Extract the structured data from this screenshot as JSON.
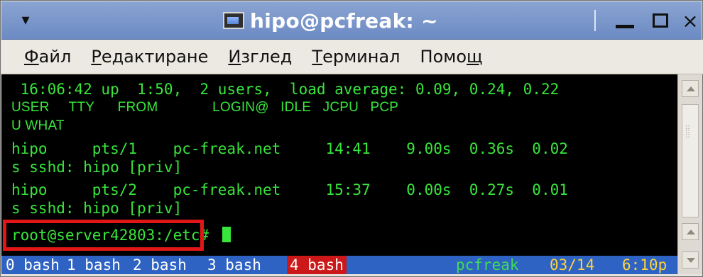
{
  "window": {
    "title": "hipo@pcfreak: ~",
    "menu_arrow": "▾",
    "controls": {
      "minimize": "minimize",
      "maximize": "maximize",
      "close": "×"
    }
  },
  "menubar": {
    "items": [
      {
        "label": "Файл",
        "prefix": "",
        "underline": "Ф",
        "rest": "айл"
      },
      {
        "label": "Редактиране",
        "prefix": "",
        "underline": "Р",
        "rest": "едактиране"
      },
      {
        "label": "Изглед",
        "prefix": "",
        "underline": "И",
        "rest": "зглед"
      },
      {
        "label": "Терминал",
        "prefix": "",
        "underline": "Т",
        "rest": "ерминал"
      },
      {
        "label": "Помощ",
        "prefix": "Помо",
        "underline": "щ",
        "rest": ""
      }
    ]
  },
  "terminal": {
    "lines": [
      " 16:06:42 up  1:50,  2 users,  load average: 0.09, 0.24, 0.22",
      "USER     TTY      FROM              LOGIN@   IDLE   JCPU   PCP",
      "U WHAT",
      "hipo     pts/1    pc-freak.net     14:41    9.00s  0.36s  0.02",
      "s sshd: hipo [priv]",
      "hipo     pts/2    pc-freak.net     15:37    0.00s  0.27s  0.01",
      "s sshd: hipo [priv]",
      "root@server42803:/etc# "
    ],
    "statusbar": {
      "tabs": [
        "0 bash",
        "1 bash",
        "2 bash",
        "3 bash",
        "4 bash"
      ],
      "active_tab": "4 bash",
      "host": "pcfreak",
      "date": "03/14",
      "time": "6:10p"
    }
  },
  "colors": {
    "terminal_text": "#38e63b",
    "statusbar_bg": "#2f63c3",
    "active_tab_bg": "#cc1818",
    "highlight_border": "#e11717",
    "titlebar_bg": "#7d98cc"
  },
  "icons": {
    "window_menu": "chevron-down-icon",
    "title_icon": "terminal-icon",
    "cursor": "pointer-icon"
  }
}
